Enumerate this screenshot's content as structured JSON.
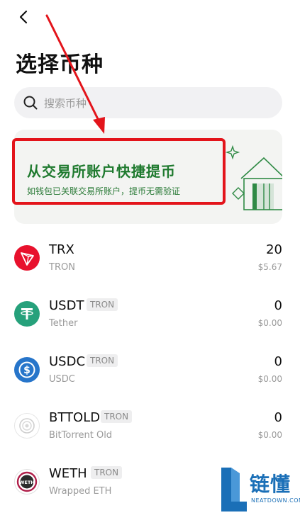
{
  "header": {
    "title": "选择币种"
  },
  "search": {
    "placeholder": "搜索币种"
  },
  "banner": {
    "title": "从交易所账户快捷提币",
    "subtitle": "如钱包已关联交易所账户，提币无需验证"
  },
  "coins": [
    {
      "symbol": "TRX",
      "chain": "",
      "name": "TRON",
      "amount": "20",
      "value": "$5.67",
      "icon": "tron-icon"
    },
    {
      "symbol": "USDT",
      "chain": "TRON",
      "name": "Tether",
      "amount": "0",
      "value": "$0.00",
      "icon": "tether-icon"
    },
    {
      "symbol": "USDC",
      "chain": "TRON",
      "name": "USDC",
      "amount": "0",
      "value": "$0.00",
      "icon": "usdc-icon"
    },
    {
      "symbol": "BTTOLD",
      "chain": "TRON",
      "name": "BitTorrent Old",
      "amount": "0",
      "value": "$0.00",
      "icon": "bittorrent-icon"
    },
    {
      "symbol": "WETH",
      "chain": "TRON",
      "name": "Wrapped ETH",
      "amount": "",
      "value": "",
      "icon": "weth-icon"
    }
  ],
  "watermark": {
    "brand": "链懂",
    "site": "NEATDOWN.COM"
  },
  "colors": {
    "accent_green": "#1f7a2f",
    "highlight_red": "#e3141b",
    "tron_red": "#e8112d",
    "tether_green": "#26a17b",
    "usdc_blue": "#2775ca"
  }
}
